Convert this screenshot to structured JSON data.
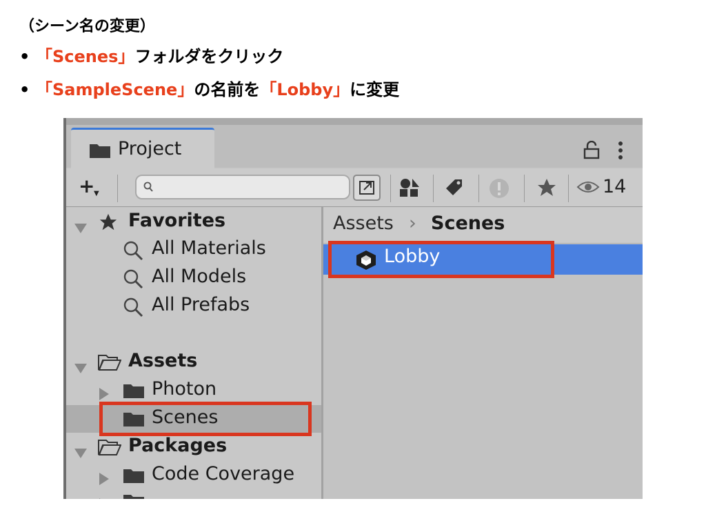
{
  "slide": {
    "heading": "（シーン名の変更）",
    "bullet_glyph": "•",
    "bullet1": {
      "highlight": "「Scenes」",
      "rest": "フォルダをクリック"
    },
    "bullet2": {
      "highlight1": "「SampleScene」",
      "middle": "の名前を",
      "highlight2": "「Lobby」",
      "rest": "に変更"
    },
    "accent_color": "#e8401c",
    "highlight_box_color": "#d9361f"
  },
  "project_window": {
    "tab_title": "Project",
    "tab_icon": "folder-icon",
    "toolbar": {
      "add_label": "+",
      "search": {
        "value": "",
        "placeholder": ""
      },
      "hidden_packages_count": "14"
    },
    "tree": {
      "favorites": {
        "label": "Favorites",
        "items": [
          "All Materials",
          "All Models",
          "All Prefabs"
        ]
      },
      "assets": {
        "label": "Assets",
        "items": [
          "Photon",
          "Scenes"
        ],
        "selected": "Scenes"
      },
      "packages": {
        "label": "Packages",
        "items": [
          "Code Coverage"
        ]
      }
    },
    "breadcrumb": {
      "root": "Assets",
      "separator": "›",
      "current": "Scenes"
    },
    "asset_item": {
      "label": "Lobby",
      "icon": "unity-scene-icon",
      "selected": true
    }
  }
}
